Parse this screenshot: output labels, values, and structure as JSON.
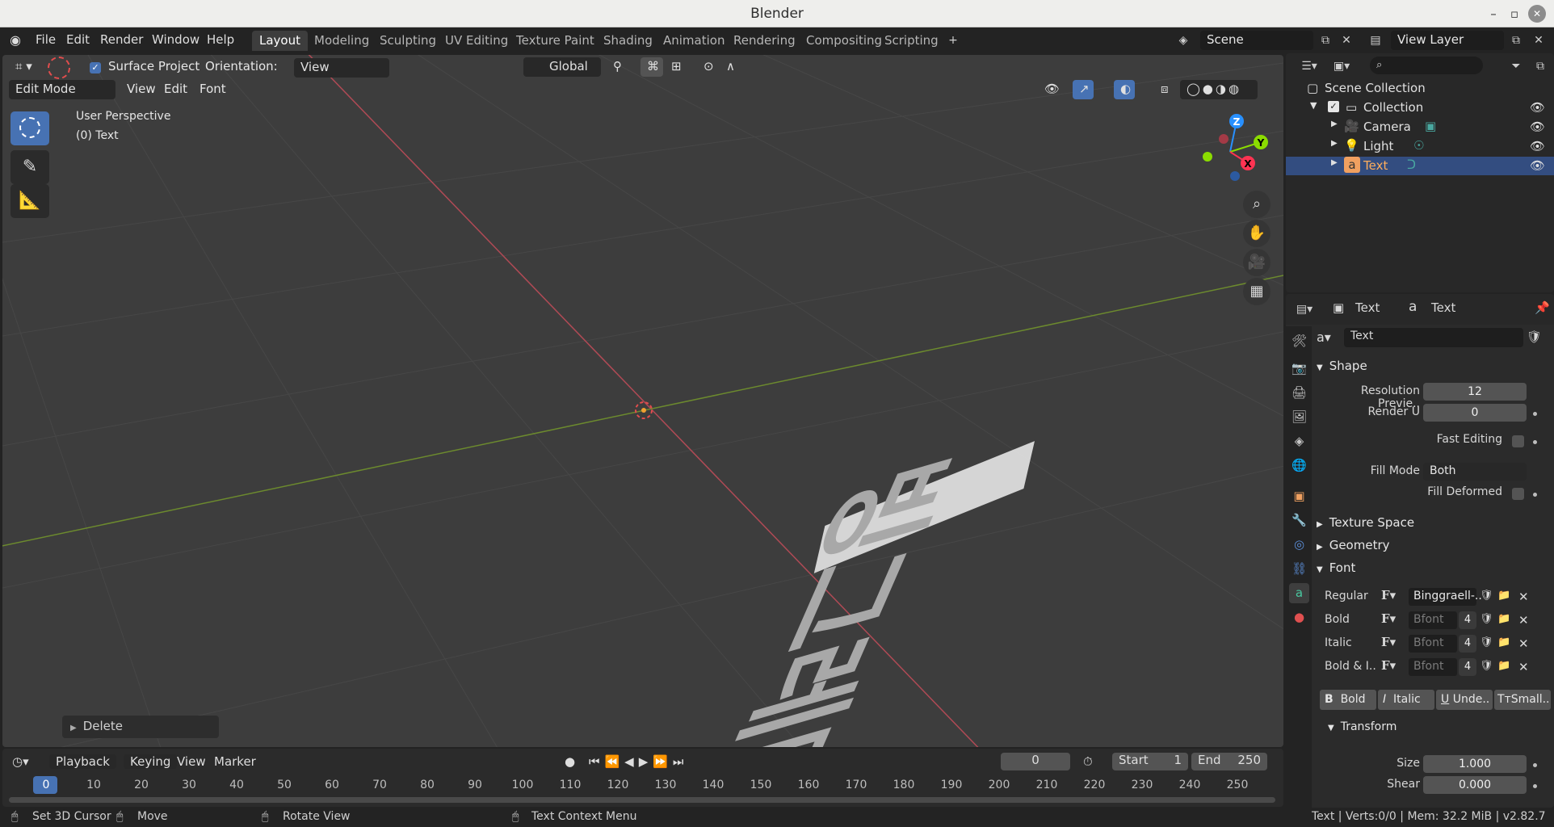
{
  "window": {
    "title": "Blender",
    "controls": [
      "–",
      "▫",
      "✕"
    ]
  },
  "menu": {
    "file": "File",
    "edit": "Edit",
    "render": "Render",
    "window": "Window",
    "help": "Help"
  },
  "workspaces": [
    "Layout",
    "Modeling",
    "Sculpting",
    "UV Editing",
    "Texture Paint",
    "Shading",
    "Animation",
    "Rendering",
    "Compositing",
    "Scripting"
  ],
  "scene": {
    "name": "Scene",
    "view_layer": "View Layer"
  },
  "tool_header": {
    "surface_project": "Surface Project",
    "orientation_label": "Orientation:",
    "orientation_value": "View",
    "transform_orientation": "Global"
  },
  "viewport_header": {
    "mode": "Edit Mode",
    "view": "View",
    "edit": "Edit",
    "font": "Font"
  },
  "viewport": {
    "perspective": "User Perspective",
    "object": "(0) Text",
    "last_operator": "Delete",
    "gizmo": {
      "z": "Z",
      "y": "Y",
      "x": "X"
    },
    "text_mesh": "빙그레다"
  },
  "timeline": {
    "playback": "Playback",
    "keying": "Keying",
    "view": "View",
    "marker": "Marker",
    "current_frame": "0",
    "start_label": "Start",
    "start_value": "1",
    "end_label": "End",
    "end_value": "250",
    "ruler": [
      "0",
      "10",
      "20",
      "30",
      "40",
      "50",
      "60",
      "70",
      "80",
      "90",
      "100",
      "110",
      "120",
      "130",
      "140",
      "150",
      "160",
      "170",
      "180",
      "190",
      "200",
      "210",
      "220",
      "230",
      "240",
      "250"
    ]
  },
  "statusbar": {
    "set_cursor": "Set 3D Cursor",
    "move": "Move",
    "rotate": "Rotate View",
    "context_menu": "Text Context Menu",
    "stats": "Text | Verts:0/0 | Mem: 32.2 MiB | v2.82.7"
  },
  "outliner": {
    "root": "Scene Collection",
    "collection": "Collection",
    "items": [
      "Camera",
      "Light",
      "Text"
    ]
  },
  "properties": {
    "breadcrumb_object": "Text",
    "breadcrumb_data": "Text",
    "datablock_name": "Text",
    "shape": {
      "title": "Shape",
      "resolution_preview_label": "Resolution Previe..",
      "resolution_preview_value": "12",
      "render_u_label": "Render U",
      "render_u_value": "0",
      "fast_editing": "Fast Editing",
      "fill_mode_label": "Fill Mode",
      "fill_mode_value": "Both",
      "fill_deformed": "Fill Deformed"
    },
    "texture_space": "Texture Space",
    "geometry": "Geometry",
    "font": {
      "title": "Font",
      "rows": [
        {
          "label": "Regular",
          "value": "Binggraell-..",
          "users": ""
        },
        {
          "label": "Bold",
          "value": "Bfont",
          "users": "4"
        },
        {
          "label": "Italic",
          "value": "Bfont",
          "users": "4"
        },
        {
          "label": "Bold & I..",
          "value": "Bfont",
          "users": "4"
        }
      ],
      "toggles": [
        "Bold",
        "Italic",
        "Unde..",
        "Small.."
      ]
    },
    "transform": {
      "title": "Transform",
      "size_label": "Size",
      "size_value": "1.000",
      "shear_label": "Shear",
      "shear_value": "0.000"
    }
  },
  "colors": {
    "accent": "#4772b3",
    "selected_row": "#334d80",
    "x_axis": "#ff3352",
    "y_axis": "#8bdc00",
    "z_axis": "#2890ff",
    "object_orange": "#f0a060",
    "viewport_bg": "#3d3d3d"
  }
}
